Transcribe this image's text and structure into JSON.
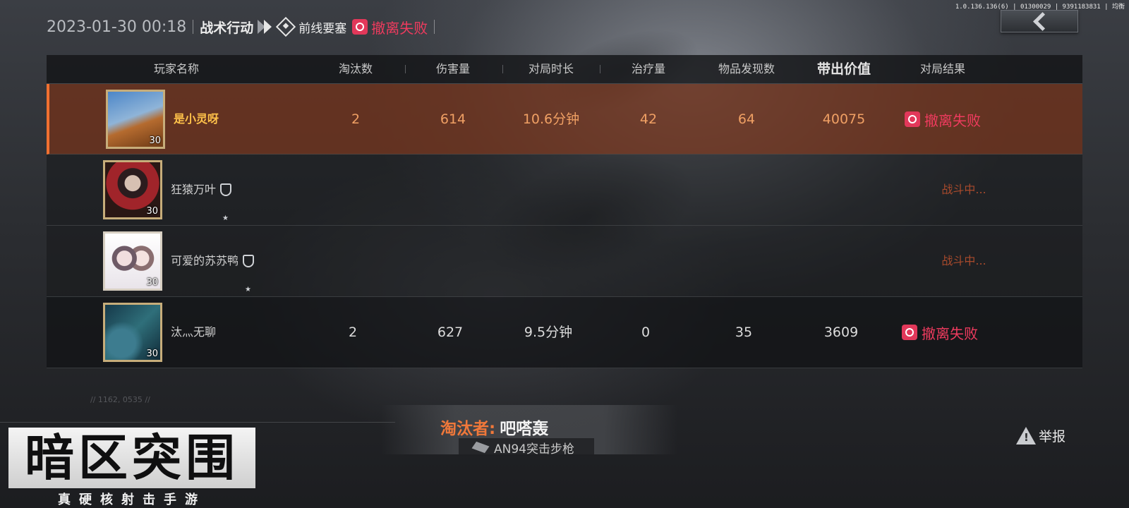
{
  "header": {
    "datetime": "2023-01-30 00:18",
    "mode": "战术行动",
    "map": "前线要塞",
    "status": "撤离失败"
  },
  "version_text": "1.0.136.136(6) | 01300029 | 9391183831 | 均衡",
  "table": {
    "columns": [
      "玩家名称",
      "淘汰数",
      "伤害量",
      "对局时长",
      "治疗量",
      "物品发现数",
      "带出价值",
      "对局结果"
    ],
    "rows": [
      {
        "name": "是小灵呀",
        "level": "30",
        "kills": "2",
        "damage": "614",
        "duration": "10.6分钟",
        "healing": "42",
        "items": "64",
        "value": "40075",
        "result": "撤离失败"
      },
      {
        "name": "狂猿万叶",
        "level": "30",
        "result": "战斗中..."
      },
      {
        "name": "可爱的苏苏鸭",
        "level": "30",
        "result": "战斗中..."
      },
      {
        "name": "汰灬无聊",
        "level": "30",
        "kills": "2",
        "damage": "627",
        "duration": "9.5分钟",
        "healing": "0",
        "items": "35",
        "value": "3609",
        "result": "撤离失败"
      }
    ]
  },
  "killer": {
    "label": "淘汰者:",
    "name": "吧嗒轰",
    "weapon": "AN94突击步枪"
  },
  "report_label": "举报",
  "coords_text": "// 1162, 0535 //",
  "logo": {
    "title": "暗区突围",
    "subtitle": "真硬核射击手游"
  },
  "colors": {
    "accent_orange": "#f07030",
    "fail_red": "#ee3b5e",
    "self_row": "#6e321c"
  }
}
